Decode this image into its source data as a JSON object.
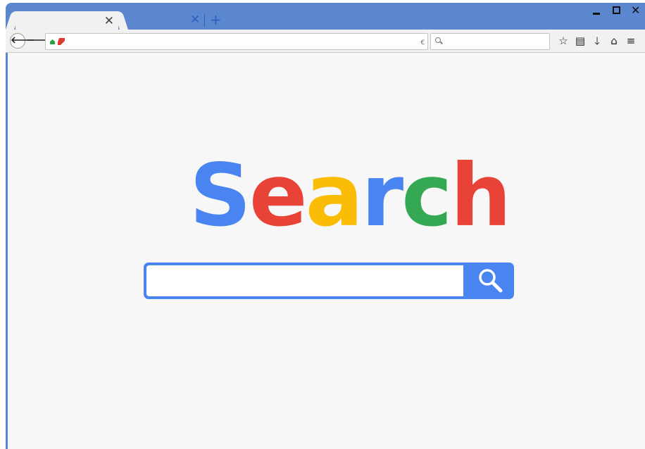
{
  "tabs": {
    "active_close_glyph": "✕",
    "inactive_close_glyph": "✕",
    "new_tab_glyph": "+"
  },
  "window_controls": {
    "close_glyph": "✕"
  },
  "toolbar": {
    "back_glyph": "🡐",
    "forward_glyph": "🡒",
    "reload_glyph": "ꞓ",
    "url_value": "",
    "search_value": "",
    "icons": [
      {
        "name": "star-icon",
        "glyph": "☆"
      },
      {
        "name": "clipboard-icon",
        "glyph": "▤"
      },
      {
        "name": "download-icon",
        "glyph": "🡓"
      },
      {
        "name": "home-icon",
        "glyph": "⌂"
      },
      {
        "name": "menu-icon",
        "glyph": "≡"
      }
    ]
  },
  "content": {
    "logo_letters": [
      "S",
      "e",
      "a",
      "r",
      "c",
      "h"
    ],
    "logo_colors": [
      "#4a84f0",
      "#e84336",
      "#fbbc05",
      "#4a84f0",
      "#34a853",
      "#e84336"
    ],
    "search_value": "",
    "accent_color": "#4a84f0"
  }
}
